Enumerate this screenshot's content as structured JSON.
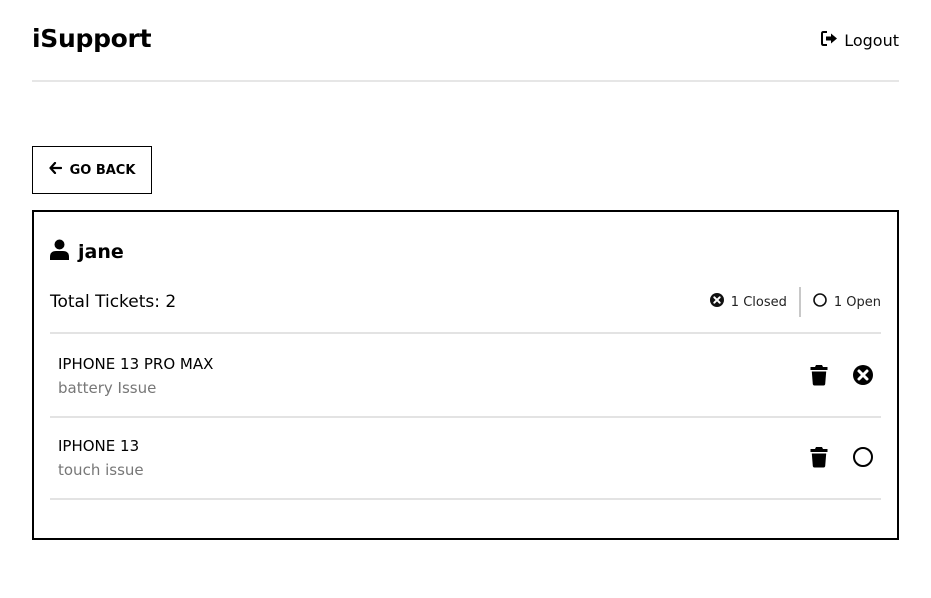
{
  "header": {
    "brand": "iSupport",
    "logout_label": "Logout"
  },
  "go_back_label": "GO BACK",
  "user": {
    "name": "jane"
  },
  "summary": {
    "total_label": "Total Tickets: 2",
    "closed_label": "1 Closed",
    "open_label": "1 Open"
  },
  "tickets": [
    {
      "title": "IPHONE 13 PRO MAX",
      "description": "battery Issue",
      "status": "closed"
    },
    {
      "title": "IPHONE 13",
      "description": "touch issue",
      "status": "open"
    }
  ],
  "icons": {
    "logout": "sign-out-icon",
    "back": "arrow-left-icon",
    "user": "user-icon",
    "closed": "times-circle-icon",
    "open": "circle-outline-icon",
    "delete": "trash-icon"
  }
}
